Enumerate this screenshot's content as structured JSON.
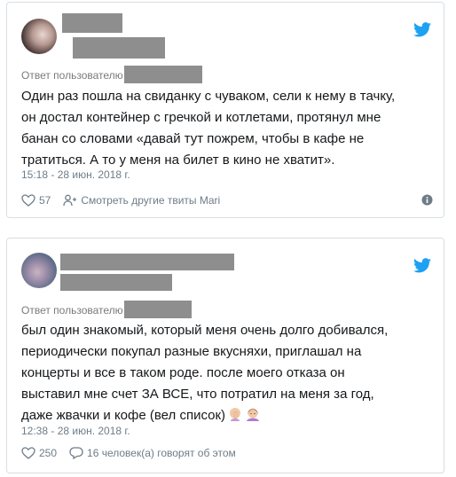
{
  "tweets": [
    {
      "reply_label": "Ответ пользователю",
      "text": "Один раз пошла на свиданку с чуваком, сели к нему в тачку,\nон достал контейнер с гречкой и котлетами, протянул мне\nбанан со словами «давай тут пожрем, чтобы в кафе не\nтратиться. А то у меня на билет в кино не хватит».",
      "timestamp": "15:18 - 28 июн. 2018 г.",
      "likes": "57",
      "secondary_action": "Смотреть другие твиты Mari",
      "icons": {
        "like": "heart-icon",
        "secondary": "user-icon",
        "info": "info-icon",
        "brand": "twitter-bird-icon"
      }
    },
    {
      "reply_label": "Ответ пользователю",
      "text": "был один знакомый, который меня очень долго добивался,\nпериодически покупал разные вкусняхи, приглашал на\nконцерты и все в таком роде. после моего отказа он\nвыставил мне счет ЗА ВСЕ, что потратил на меня за год,\nдаже жвачки и кофе (вел список)",
      "timestamp": "12:38 - 28 июн. 2018 г.",
      "likes": "250",
      "secondary_action": "16 человек(а) говорят об этом",
      "icons": {
        "like": "heart-icon",
        "secondary": "comment-icon",
        "info": "info-icon",
        "brand": "twitter-bird-icon"
      }
    }
  ],
  "colors": {
    "twitter_blue": "#1da1f2",
    "text": "#14171a",
    "meta": "#6e7c88",
    "redaction": "#8e8e8e"
  }
}
